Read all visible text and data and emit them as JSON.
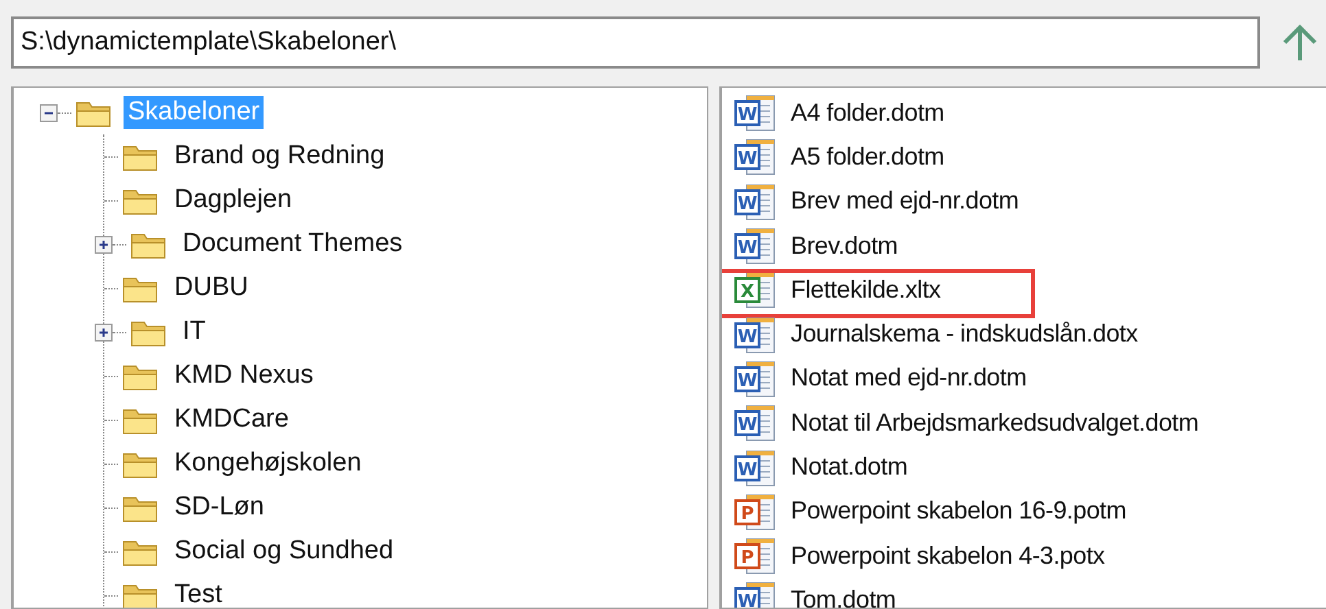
{
  "path_field": {
    "value": "S:\\dynamictemplate\\Skabeloner\\"
  },
  "folder_tree": [
    {
      "label": "Skabeloner",
      "selected": true,
      "has_children": true,
      "expanded": true,
      "children": [
        {
          "label": "Brand og Redning",
          "selected": false,
          "has_children": false
        },
        {
          "label": "Dagplejen",
          "selected": false,
          "has_children": false
        },
        {
          "label": "Document Themes",
          "selected": false,
          "has_children": true,
          "expanded": false
        },
        {
          "label": "DUBU",
          "selected": false,
          "has_children": false
        },
        {
          "label": "IT",
          "selected": false,
          "has_children": true,
          "expanded": false
        },
        {
          "label": "KMD Nexus",
          "selected": false,
          "has_children": false
        },
        {
          "label": "KMDCare",
          "selected": false,
          "has_children": false
        },
        {
          "label": "Kongehøjskolen",
          "selected": false,
          "has_children": false
        },
        {
          "label": "SD-Løn",
          "selected": false,
          "has_children": false
        },
        {
          "label": "Social og Sundhed",
          "selected": false,
          "has_children": false
        },
        {
          "label": "Test",
          "selected": false,
          "has_children": false
        }
      ]
    }
  ],
  "files": [
    {
      "name": "A4 folder.dotm",
      "kind": "word",
      "icon_letter": "W",
      "highlighted": false
    },
    {
      "name": "A5 folder.dotm",
      "kind": "word",
      "icon_letter": "W",
      "highlighted": false
    },
    {
      "name": "Brev med ejd-nr.dotm",
      "kind": "word",
      "icon_letter": "W",
      "highlighted": false
    },
    {
      "name": "Brev.dotm",
      "kind": "word",
      "icon_letter": "W",
      "highlighted": false
    },
    {
      "name": "Flettekilde.xltx",
      "kind": "excel",
      "icon_letter": "X",
      "highlighted": true
    },
    {
      "name": "Journalskema -  indskudslån.dotx",
      "kind": "word",
      "icon_letter": "W",
      "highlighted": false
    },
    {
      "name": "Notat med ejd-nr.dotm",
      "kind": "word",
      "icon_letter": "W",
      "highlighted": false
    },
    {
      "name": "Notat til Arbejdsmarkedsudvalget.dotm",
      "kind": "word",
      "icon_letter": "W",
      "highlighted": false
    },
    {
      "name": "Notat.dotm",
      "kind": "word",
      "icon_letter": "W",
      "highlighted": false
    },
    {
      "name": "Powerpoint skabelon 16-9.potm",
      "kind": "powerpoint",
      "icon_letter": "P",
      "highlighted": false
    },
    {
      "name": "Powerpoint skabelon 4-3.potx",
      "kind": "powerpoint",
      "icon_letter": "P",
      "highlighted": false
    },
    {
      "name": "Tom.dotm",
      "kind": "word",
      "icon_letter": "W",
      "highlighted": false
    }
  ]
}
